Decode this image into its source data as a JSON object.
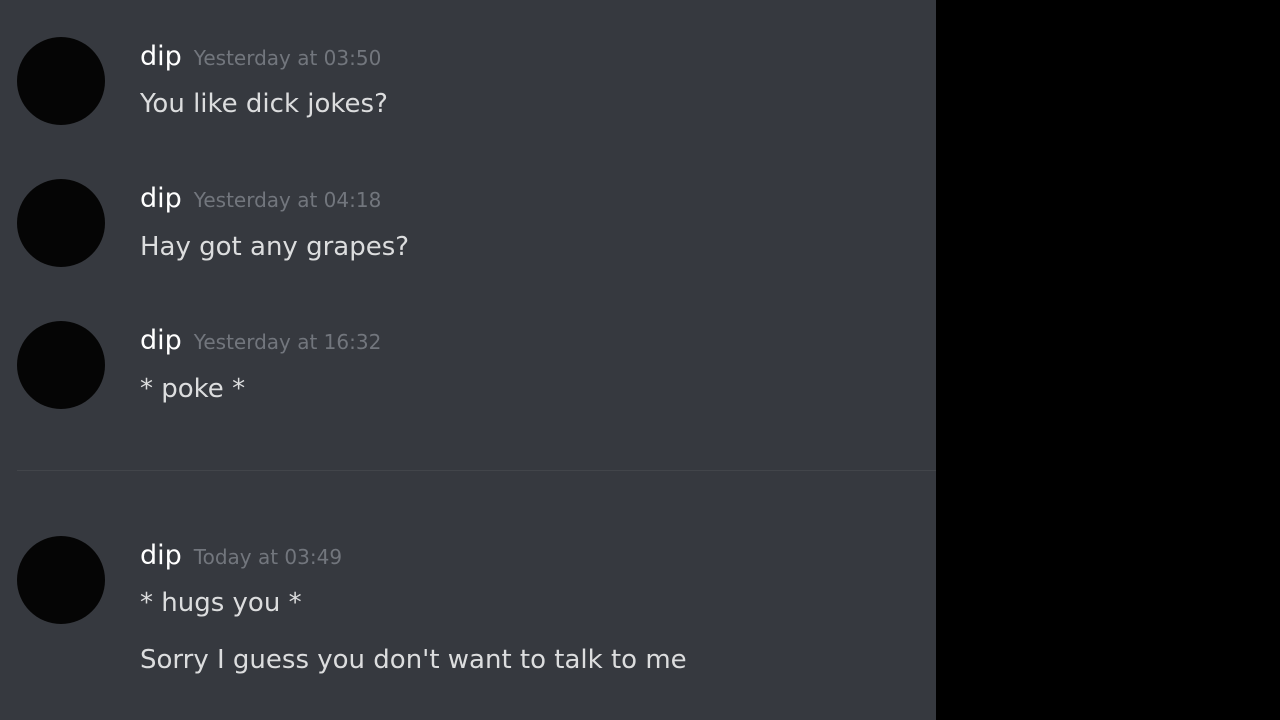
{
  "messages": [
    {
      "username": "dip",
      "timestamp": "Yesterday at 03:50",
      "lines": [
        "You like dick jokes?"
      ]
    },
    {
      "username": "dip",
      "timestamp": "Yesterday at 04:18",
      "lines": [
        "Hay got any grapes?"
      ]
    },
    {
      "username": "dip",
      "timestamp": "Yesterday at 16:32",
      "lines": [
        "* poke *"
      ]
    },
    {
      "username": "dip",
      "timestamp": "Today at 03:49",
      "lines": [
        "* hugs you *",
        "Sorry I guess you don't want to talk to me"
      ]
    }
  ],
  "colors": {
    "chat_background": "#36393f",
    "username": "#ffffff",
    "timestamp": "#72767d",
    "message_text": "#dcddde",
    "avatar": "#050505"
  }
}
